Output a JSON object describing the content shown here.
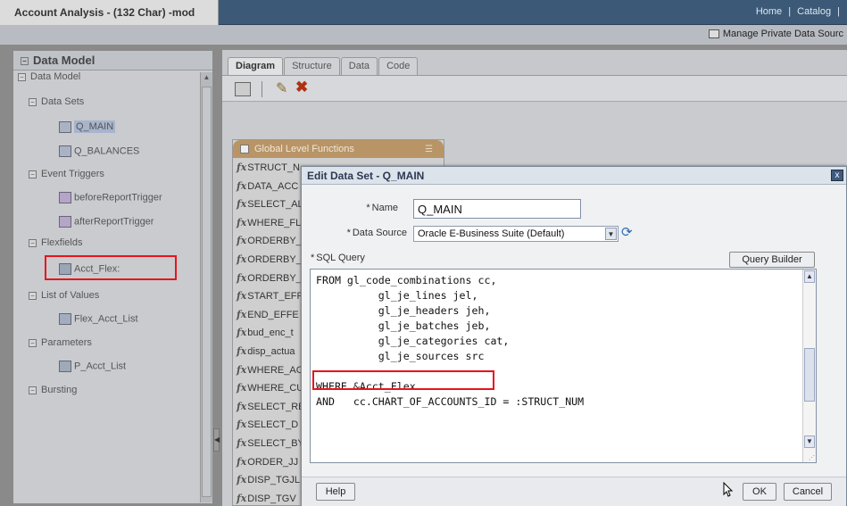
{
  "app": {
    "title": "Account Analysis - (132 Char) -mod",
    "nav": [
      "Home",
      "|",
      "Catalog",
      "|"
    ],
    "manage_link": "Manage Private Data Sourc"
  },
  "left_panel": {
    "header": "Data Model",
    "tree": [
      {
        "label": "Data Model",
        "level": 0,
        "expander": "minus"
      },
      {
        "label": "Data Sets",
        "level": 1,
        "expander": "minus"
      },
      {
        "label": "Q_MAIN",
        "level": 2,
        "icon": "dataset-icon",
        "selected": true
      },
      {
        "label": "Q_BALANCES",
        "level": 2,
        "icon": "dataset-icon"
      },
      {
        "label": "Event Triggers",
        "level": 1,
        "expander": "minus"
      },
      {
        "label": "beforeReportTrigger",
        "level": 2,
        "icon": "trigger-icon"
      },
      {
        "label": "afterReportTrigger",
        "level": 2,
        "icon": "trigger-icon"
      },
      {
        "label": "Flexfields",
        "level": 1,
        "expander": "minus"
      },
      {
        "label": "Acct_Flex:",
        "level": 2,
        "icon": "flexfield-icon",
        "highlighted": true
      },
      {
        "label": "List of Values",
        "level": 1,
        "expander": "minus"
      },
      {
        "label": "Flex_Acct_List",
        "level": 2,
        "icon": "list-icon"
      },
      {
        "label": "Parameters",
        "level": 1,
        "expander": "minus"
      },
      {
        "label": "P_Acct_List",
        "level": 2,
        "icon": "parameter-icon"
      },
      {
        "label": "Bursting",
        "level": 1,
        "expander": "minus"
      }
    ]
  },
  "tabs": [
    "Diagram",
    "Structure",
    "Data",
    "Code"
  ],
  "active_tab": "Diagram",
  "global_functions": {
    "header": "Global Level Functions",
    "items": [
      "STRUCT_N",
      "DATA_ACC",
      "SELECT_AL",
      "WHERE_FL",
      "ORDERBY_",
      "ORDERBY_",
      "ORDERBY_",
      "START_EFF",
      "END_EFFE",
      "bud_enc_t",
      "disp_actua",
      "WHERE_AC",
      "WHERE_CU",
      "SELECT_RE",
      "SELECT_D",
      "SELECT_BY",
      "ORDER_JJ",
      "DISP_TGJL",
      "DISP_TGV"
    ]
  },
  "dialog": {
    "title": "Edit Data Set - Q_MAIN",
    "close": "x",
    "name_label": "Name",
    "name_value": "Q_MAIN",
    "data_source_label": "Data Source",
    "data_source_value": "Oracle E-Business Suite (Default)",
    "sql_label": "SQL Query",
    "query_builder": "Query Builder",
    "sql_lines": [
      "FROM gl_code_combinations cc,",
      "          gl_je_lines jel,",
      "          gl_je_headers jeh,",
      "          gl_je_batches jeb,",
      "          gl_je_categories cat,",
      "          gl_je_sources src",
      "",
      "WHERE &Acct_Flex",
      "AND   cc.CHART_OF_ACCOUNTS_ID = :STRUCT_NUM"
    ],
    "help": "Help",
    "ok": "OK",
    "cancel": "Cancel"
  },
  "colors": {
    "highlight": "#e8141c",
    "title_bar": "#3c5a78",
    "panel_header": "#b89466"
  }
}
